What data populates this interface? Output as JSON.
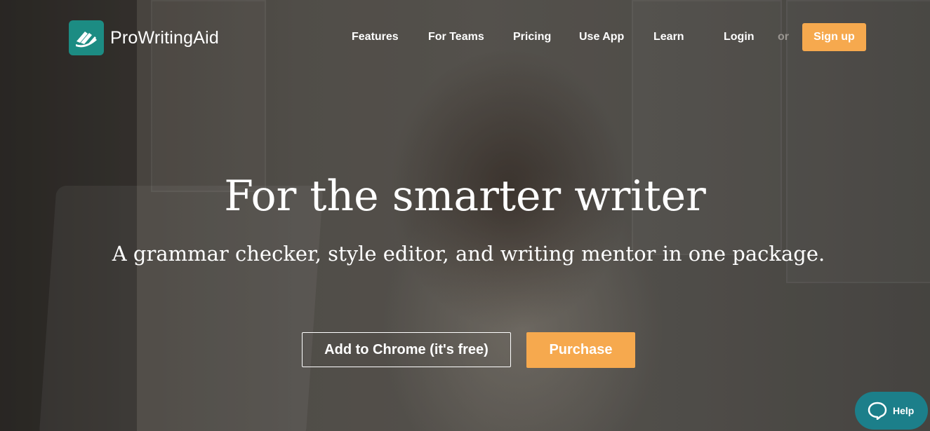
{
  "brand": {
    "name": "ProWritingAid",
    "accent_color": "#1c8c83"
  },
  "nav": {
    "items": [
      {
        "label": "Features"
      },
      {
        "label": "For Teams"
      },
      {
        "label": "Pricing"
      },
      {
        "label": "Use App"
      },
      {
        "label": "Learn"
      }
    ],
    "login_label": "Login",
    "or_label": "or",
    "signup_label": "Sign up",
    "signup_color": "#f6a94e"
  },
  "hero": {
    "title": "For the smarter writer",
    "subtitle": "A grammar checker, style editor, and writing mentor in one package.",
    "primary_cta": "Add to Chrome (it's free)",
    "secondary_cta": "Purchase",
    "secondary_cta_color": "#f6a94e"
  },
  "help_widget": {
    "label": "Help",
    "icon": "chat-bubble-icon",
    "color": "#1c7f8a"
  }
}
